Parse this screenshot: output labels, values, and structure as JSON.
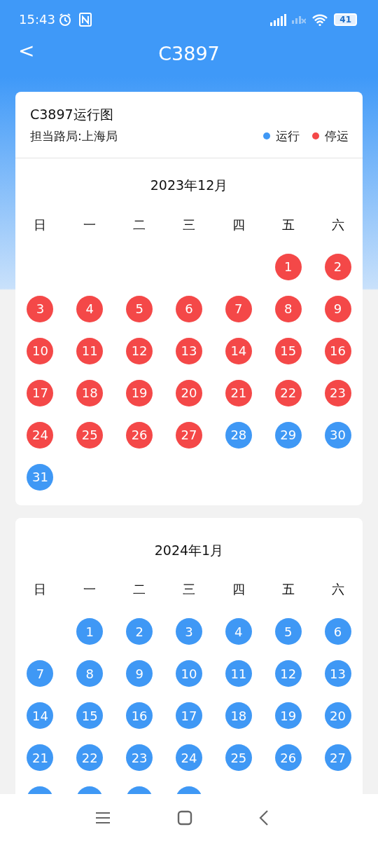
{
  "status_bar": {
    "time": "15:43",
    "battery": "41"
  },
  "header": {
    "back": "<",
    "title": "C3897"
  },
  "info": {
    "title": "C3897运行图",
    "bureau": "担当路局:上海局",
    "legend": [
      {
        "label": "运行",
        "color": "#3f98f5"
      },
      {
        "label": "停运",
        "color": "#f44848"
      }
    ]
  },
  "months": [
    {
      "title": "2023年12月",
      "weekdays": [
        "日",
        "一",
        "二",
        "三",
        "四",
        "五",
        "六"
      ],
      "weeks": [
        [
          {
            "kind": "blank"
          },
          {
            "kind": "blank"
          },
          {
            "kind": "blank"
          },
          {
            "kind": "blank"
          },
          {
            "kind": "blank"
          },
          {
            "kind": "day",
            "day": "1",
            "running": false
          },
          {
            "kind": "day",
            "day": "2",
            "running": false
          }
        ],
        [
          {
            "kind": "day",
            "day": "3",
            "running": false
          },
          {
            "kind": "day",
            "day": "4",
            "running": false
          },
          {
            "kind": "day",
            "day": "5",
            "running": false
          },
          {
            "kind": "day",
            "day": "6",
            "running": false
          },
          {
            "kind": "day",
            "day": "7",
            "running": false
          },
          {
            "kind": "day",
            "day": "8",
            "running": false
          },
          {
            "kind": "day",
            "day": "9",
            "running": false
          }
        ],
        [
          {
            "kind": "day",
            "day": "10",
            "running": false
          },
          {
            "kind": "day",
            "day": "11",
            "running": false
          },
          {
            "kind": "day",
            "day": "12",
            "running": false
          },
          {
            "kind": "day",
            "day": "13",
            "running": false
          },
          {
            "kind": "day",
            "day": "14",
            "running": false
          },
          {
            "kind": "day",
            "day": "15",
            "running": false
          },
          {
            "kind": "day",
            "day": "16",
            "running": false
          }
        ],
        [
          {
            "kind": "day",
            "day": "17",
            "running": false
          },
          {
            "kind": "day",
            "day": "18",
            "running": false
          },
          {
            "kind": "day",
            "day": "19",
            "running": false
          },
          {
            "kind": "day",
            "day": "20",
            "running": false
          },
          {
            "kind": "day",
            "day": "21",
            "running": false
          },
          {
            "kind": "day",
            "day": "22",
            "running": false
          },
          {
            "kind": "day",
            "day": "23",
            "running": false
          }
        ],
        [
          {
            "kind": "day",
            "day": "24",
            "running": false
          },
          {
            "kind": "day",
            "day": "25",
            "running": false
          },
          {
            "kind": "day",
            "day": "26",
            "running": false
          },
          {
            "kind": "day",
            "day": "27",
            "running": false
          },
          {
            "kind": "day",
            "day": "28",
            "running": true
          },
          {
            "kind": "day",
            "day": "29",
            "running": true
          },
          {
            "kind": "day",
            "day": "30",
            "running": true
          }
        ],
        [
          {
            "kind": "day",
            "day": "31",
            "running": true
          }
        ]
      ]
    },
    {
      "title": "2024年1月",
      "weekdays": [
        "日",
        "一",
        "二",
        "三",
        "四",
        "五",
        "六"
      ],
      "weeks": [
        [
          {
            "kind": "blank"
          },
          {
            "kind": "day",
            "day": "1",
            "running": true
          },
          {
            "kind": "day",
            "day": "2",
            "running": true
          },
          {
            "kind": "day",
            "day": "3",
            "running": true
          },
          {
            "kind": "day",
            "day": "4",
            "running": true
          },
          {
            "kind": "day",
            "day": "5",
            "running": true
          },
          {
            "kind": "day",
            "day": "6",
            "running": true
          }
        ],
        [
          {
            "kind": "day",
            "day": "7",
            "running": true
          },
          {
            "kind": "day",
            "day": "8",
            "running": true
          },
          {
            "kind": "day",
            "day": "9",
            "running": true
          },
          {
            "kind": "day",
            "day": "10",
            "running": true
          },
          {
            "kind": "day",
            "day": "11",
            "running": true
          },
          {
            "kind": "day",
            "day": "12",
            "running": true
          },
          {
            "kind": "day",
            "day": "13",
            "running": true
          }
        ],
        [
          {
            "kind": "day",
            "day": "14",
            "running": true
          },
          {
            "kind": "day",
            "day": "15",
            "running": true
          },
          {
            "kind": "day",
            "day": "16",
            "running": true
          },
          {
            "kind": "day",
            "day": "17",
            "running": true
          },
          {
            "kind": "day",
            "day": "18",
            "running": true
          },
          {
            "kind": "day",
            "day": "19",
            "running": true
          },
          {
            "kind": "day",
            "day": "20",
            "running": true
          }
        ],
        [
          {
            "kind": "day",
            "day": "21",
            "running": true
          },
          {
            "kind": "day",
            "day": "22",
            "running": true
          },
          {
            "kind": "day",
            "day": "23",
            "running": true
          },
          {
            "kind": "day",
            "day": "24",
            "running": true
          },
          {
            "kind": "day",
            "day": "25",
            "running": true
          },
          {
            "kind": "day",
            "day": "26",
            "running": true
          },
          {
            "kind": "day",
            "day": "27",
            "running": true
          }
        ],
        [
          {
            "kind": "cut",
            "running": true
          },
          {
            "kind": "cut",
            "running": true
          },
          {
            "kind": "cut",
            "running": true
          },
          {
            "kind": "cut",
            "running": true
          }
        ]
      ]
    }
  ]
}
